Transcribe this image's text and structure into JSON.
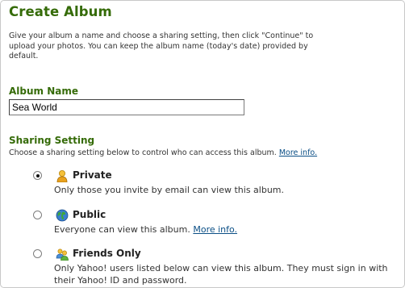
{
  "page": {
    "title": "Create Album",
    "intro": "Give your album a name and choose a sharing setting, then click \"Continue\" to\nupload your photos. You can keep the album name (today's date) provided by\ndefault."
  },
  "album_name": {
    "heading": "Album Name",
    "value": "Sea World"
  },
  "sharing": {
    "heading": "Sharing Setting",
    "description": "Choose a sharing setting below to control who can access this album.",
    "more_info": "More info.",
    "selected": "private",
    "options": [
      {
        "id": "private",
        "label": "Private",
        "icon": "person-icon",
        "description": "Only those you invite by email can view this album."
      },
      {
        "id": "public",
        "label": "Public",
        "icon": "globe-icon",
        "description": "Everyone can view this album.",
        "more_info": "More info."
      },
      {
        "id": "friends",
        "label": "Friends Only",
        "icon": "people-icon",
        "description": "Only Yahoo! users listed below can view this album. They must sign in with their Yahoo! ID and password."
      }
    ]
  },
  "colors": {
    "heading": "#356b08",
    "link": "#0b4f86",
    "text": "#333333"
  }
}
